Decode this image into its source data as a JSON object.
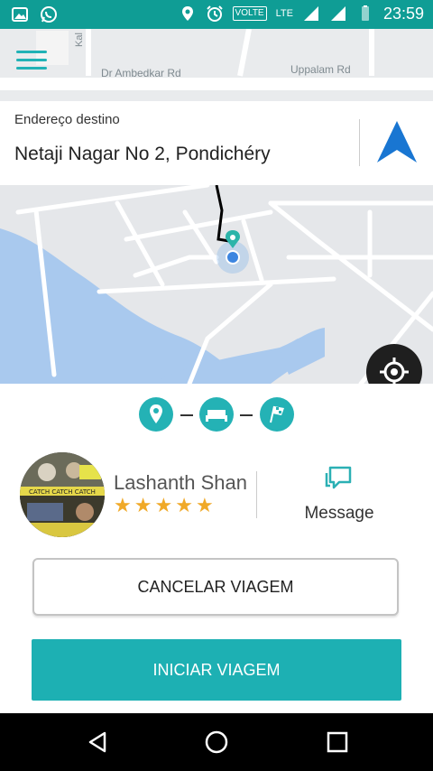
{
  "status_bar": {
    "time": "23:59",
    "volte": "VOLTE",
    "network": "LTE",
    "icons": [
      "gallery-icon",
      "whatsapp-icon",
      "location-icon",
      "alarm-icon",
      "signal-icon",
      "signal-icon",
      "battery-icon"
    ]
  },
  "top_map": {
    "roads": [
      "Dr Ambedkar Rd",
      "Uppalam Rd",
      "Kal"
    ]
  },
  "destination": {
    "label": "Endereço destino",
    "value": "Netaji Nagar No 2, Pondichéry"
  },
  "trip_steps": [
    "pickup-pin-icon",
    "bed-icon",
    "finish-flag-icon"
  ],
  "driver": {
    "name": "Lashanth Shan",
    "rating": 5,
    "stars": "★★★★★",
    "avatar_text": {
      "banner": "CATCH CATCH CATCH"
    }
  },
  "message": {
    "label": "Message"
  },
  "buttons": {
    "cancel": "CANCELAR VIAGEM",
    "start": "INICIAR VIAGEM"
  },
  "colors": {
    "accent": "#1db0b3",
    "status_bar": "#0f9d95",
    "nav_arrow": "#1976d2",
    "star": "#f0a928",
    "water": "#a9c9ee"
  }
}
